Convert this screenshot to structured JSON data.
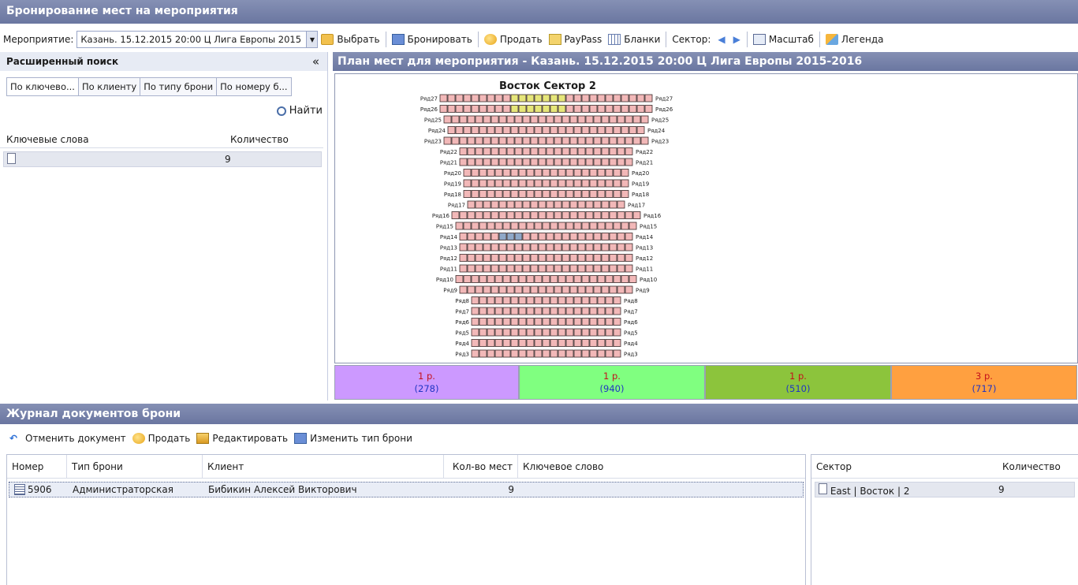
{
  "app": {
    "title": "Бронирование мест на мероприятия"
  },
  "toolbar": {
    "event_label": "Мероприятие:",
    "event_value": "Казань. 15.12.2015 20:00 Ц Лига Европы 2015",
    "select": "Выбрать",
    "book": "Бронировать",
    "sell": "Продать",
    "paypass": "PayPass",
    "blanks": "Бланки",
    "sector_label": "Сектор:",
    "scale": "Масштаб",
    "legend": "Легенда"
  },
  "search": {
    "title": "Расширенный поиск",
    "collapse": "«",
    "tabs": [
      "По ключево...",
      "По клиенту",
      "По типу брони",
      "По номеру б..."
    ],
    "find": "Найти",
    "columns": [
      "Ключевые слова",
      "Количество"
    ],
    "rows": [
      {
        "keyword": "",
        "count": "9"
      }
    ]
  },
  "plan": {
    "title": "План мест для мероприятия - Казань. 15.12.2015 20:00 Ц Лига Европы 2015-2016",
    "sector": "Восток Сектор 2",
    "rows": [
      {
        "label": "Ряд27",
        "seats": 27
      },
      {
        "label": "Ряд26",
        "seats": 27
      },
      {
        "label": "Ряд25",
        "seats": 26
      },
      {
        "label": "Ряд24",
        "seats": 25
      },
      {
        "label": "Ряд23",
        "seats": 26
      },
      {
        "label": "Ряд22",
        "seats": 22
      },
      {
        "label": "Ряд21",
        "seats": 22
      },
      {
        "label": "Ряд20",
        "seats": 21
      },
      {
        "label": "Ряд19",
        "seats": 21
      },
      {
        "label": "Ряд18",
        "seats": 21
      },
      {
        "label": "Ряд17",
        "seats": 20
      },
      {
        "label": "Ряд16",
        "seats": 24
      },
      {
        "label": "Ряд15",
        "seats": 23
      },
      {
        "label": "Ряд14",
        "seats": 22
      },
      {
        "label": "Ряд13",
        "seats": 22
      },
      {
        "label": "Ряд12",
        "seats": 22
      },
      {
        "label": "Ряд11",
        "seats": 22
      },
      {
        "label": "Ряд10",
        "seats": 23
      },
      {
        "label": "Ряд9",
        "seats": 22
      },
      {
        "label": "Ряд8",
        "seats": 19
      },
      {
        "label": "Ряд7",
        "seats": 19
      },
      {
        "label": "Ряд6",
        "seats": 19
      },
      {
        "label": "Ряд5",
        "seats": 19
      },
      {
        "label": "Ряд4",
        "seats": 19
      },
      {
        "label": "Ряд3",
        "seats": 19
      }
    ],
    "prices": [
      {
        "price": "1 р.",
        "count": "(278)",
        "color": "#cc99ff"
      },
      {
        "price": "1 р.",
        "count": "(940)",
        "color": "#80ff80"
      },
      {
        "price": "1 р.",
        "count": "(510)",
        "color": "#8cc43c"
      },
      {
        "price": "3 р.",
        "count": "(717)",
        "color": "#ffa040"
      }
    ]
  },
  "journal": {
    "title": "Журнал документов брони",
    "actions": {
      "cancel": "Отменить документ",
      "sell": "Продать",
      "edit": "Редактировать",
      "change_type": "Изменить тип брони"
    },
    "columns": [
      "Номер",
      "Тип брони",
      "Клиент",
      "Кол-во мест",
      "Ключевое слово"
    ],
    "rows": [
      {
        "number": "5906",
        "type": "Администраторская",
        "client": "Бибикин Алексей Викторович",
        "seats": "9",
        "keyword": ""
      }
    ],
    "sector_columns": [
      "Сектор",
      "Количество"
    ],
    "sector_rows": [
      {
        "sector": "East | Восток | 2",
        "count": "9"
      }
    ]
  }
}
